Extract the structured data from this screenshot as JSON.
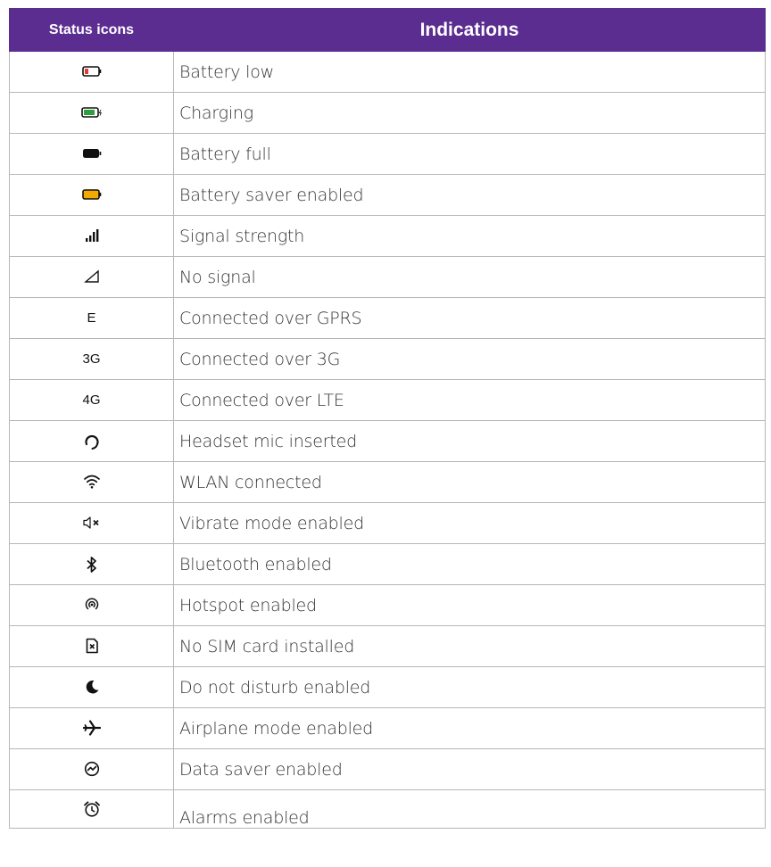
{
  "table": {
    "headers": {
      "icon_col": "Status icons",
      "indication_col": "Indications"
    },
    "colors": {
      "header_bg": "#5c2d91",
      "battery_low": "#e53935",
      "charging": "#2e9e3f",
      "battery_saver": "#f2a900"
    },
    "rows": [
      {
        "icon": "battery-low-icon",
        "label": "Battery low"
      },
      {
        "icon": "battery-charging-icon",
        "label": "Charging"
      },
      {
        "icon": "battery-full-icon",
        "label": "Battery full"
      },
      {
        "icon": "battery-saver-icon",
        "label": "Battery saver enabled"
      },
      {
        "icon": "signal-strength-icon",
        "label": "Signal strength"
      },
      {
        "icon": "no-signal-icon",
        "label": "No signal"
      },
      {
        "icon": "gprs-icon",
        "glyph": "E",
        "label": "Connected over GPRS"
      },
      {
        "icon": "3g-icon",
        "glyph": "3G",
        "label": "Connected over 3G"
      },
      {
        "icon": "4g-icon",
        "glyph": "4G",
        "label": "Connected over LTE"
      },
      {
        "icon": "headset-icon",
        "label": "Headset mic inserted"
      },
      {
        "icon": "wifi-icon",
        "label": "WLAN connected"
      },
      {
        "icon": "vibrate-mute-icon",
        "label": "Vibrate mode enabled"
      },
      {
        "icon": "bluetooth-icon",
        "label": "Bluetooth enabled"
      },
      {
        "icon": "hotspot-icon",
        "label": "Hotspot enabled"
      },
      {
        "icon": "no-sim-icon",
        "label": "No SIM card installed"
      },
      {
        "icon": "moon-icon",
        "label": "Do not disturb enabled"
      },
      {
        "icon": "airplane-icon",
        "label": "Airplane mode enabled"
      },
      {
        "icon": "data-saver-icon",
        "label": "Data saver enabled"
      },
      {
        "icon": "alarm-icon",
        "label": "Alarms enabled"
      }
    ]
  }
}
